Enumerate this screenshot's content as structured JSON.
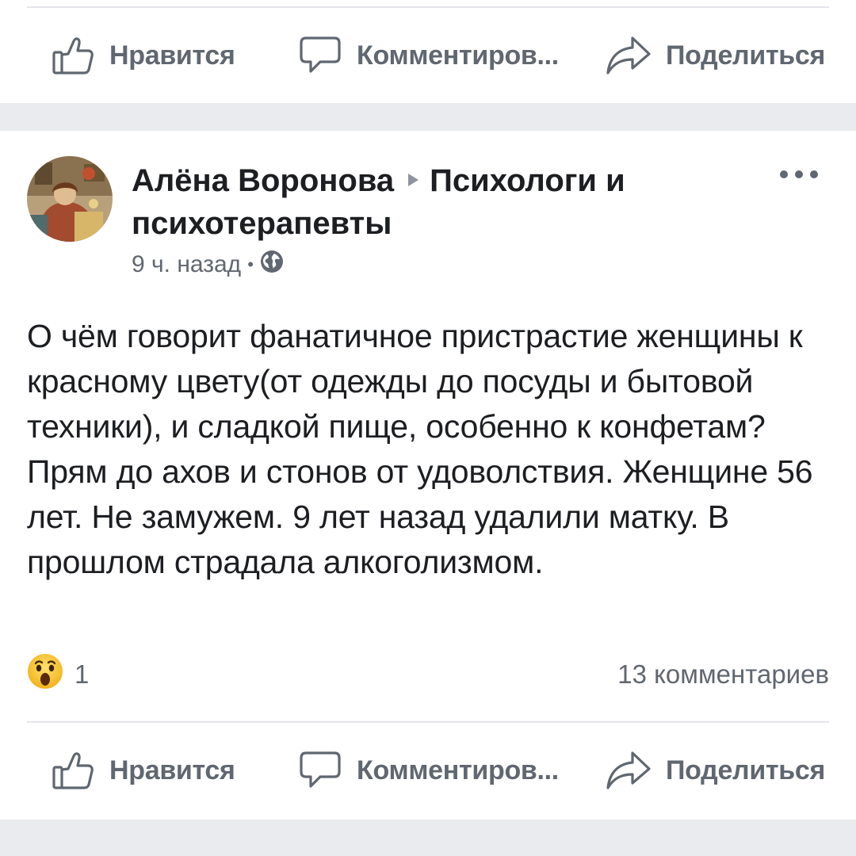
{
  "actions": {
    "like_label": "Нравится",
    "comment_label": "Комментиров...",
    "share_label": "Поделиться"
  },
  "post": {
    "author": "Алёна Воронова",
    "group": "Психологи и психотерапевты",
    "time": "9 ч. назад",
    "visibility_icon": "globe-icon",
    "text": "О чём говорит фанатичное пристрастие женщины к красному цвету(от одежды до посуды и бытовой техники), и сладкой пище, особенно к конфетам? Прям до ахов и стонов от удоволствия. Женщине 56 лет. Не замужем. 9 лет назад удалили матку. В прошлом страдала алкоголизмом.",
    "reaction_icon": "wow-emoji-icon",
    "reaction_count": "1",
    "comments_count": "13 комментариев"
  },
  "colors": {
    "text": "#1c1e21",
    "secondary": "#606770",
    "divider": "#e4e6eb",
    "feed_gap": "#e9ebee"
  }
}
